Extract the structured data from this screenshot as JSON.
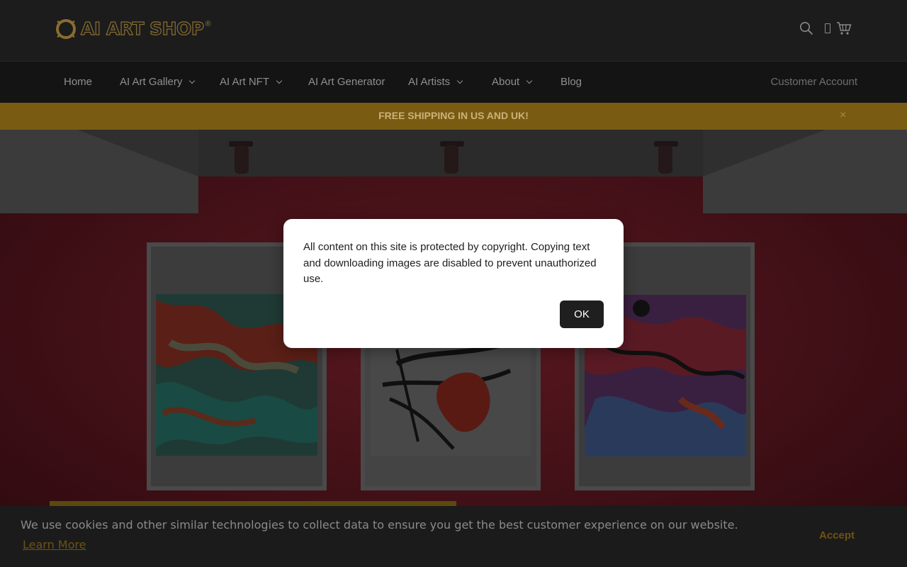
{
  "header": {
    "logo_text": "AI ART SHOP",
    "logo_mark": "®",
    "icons": [
      "search-icon",
      "cart-icon"
    ]
  },
  "nav": {
    "items": [
      {
        "label": "Home",
        "dropdown": false
      },
      {
        "label": "AI Art Gallery",
        "dropdown": true
      },
      {
        "label": "AI Art NFT",
        "dropdown": true
      },
      {
        "label": "AI Art Generator",
        "dropdown": false
      },
      {
        "label": "AI Artists",
        "dropdown": true
      },
      {
        "label": "About",
        "dropdown": true
      },
      {
        "label": "Blog",
        "dropdown": false
      }
    ],
    "account_label": "Customer Account"
  },
  "announcement": {
    "text": "FREE SHIPPING IN US AND UK!",
    "close_glyph": "×"
  },
  "modal": {
    "message": "All content on this site is protected by copyright. Copying text and downloading images are disabled to prevent unauthorized use.",
    "ok_label": "OK"
  },
  "cookie_bar": {
    "text": "We use cookies and other similar technologies to collect data to ensure you get the best customer experience on our website.",
    "learn_more": "Learn More",
    "accept_label": "Accept"
  },
  "colors": {
    "accent_gold": "#7a5b12",
    "gallery_wall": "#8c1e2c",
    "header_bg": "#1c1c1c"
  }
}
